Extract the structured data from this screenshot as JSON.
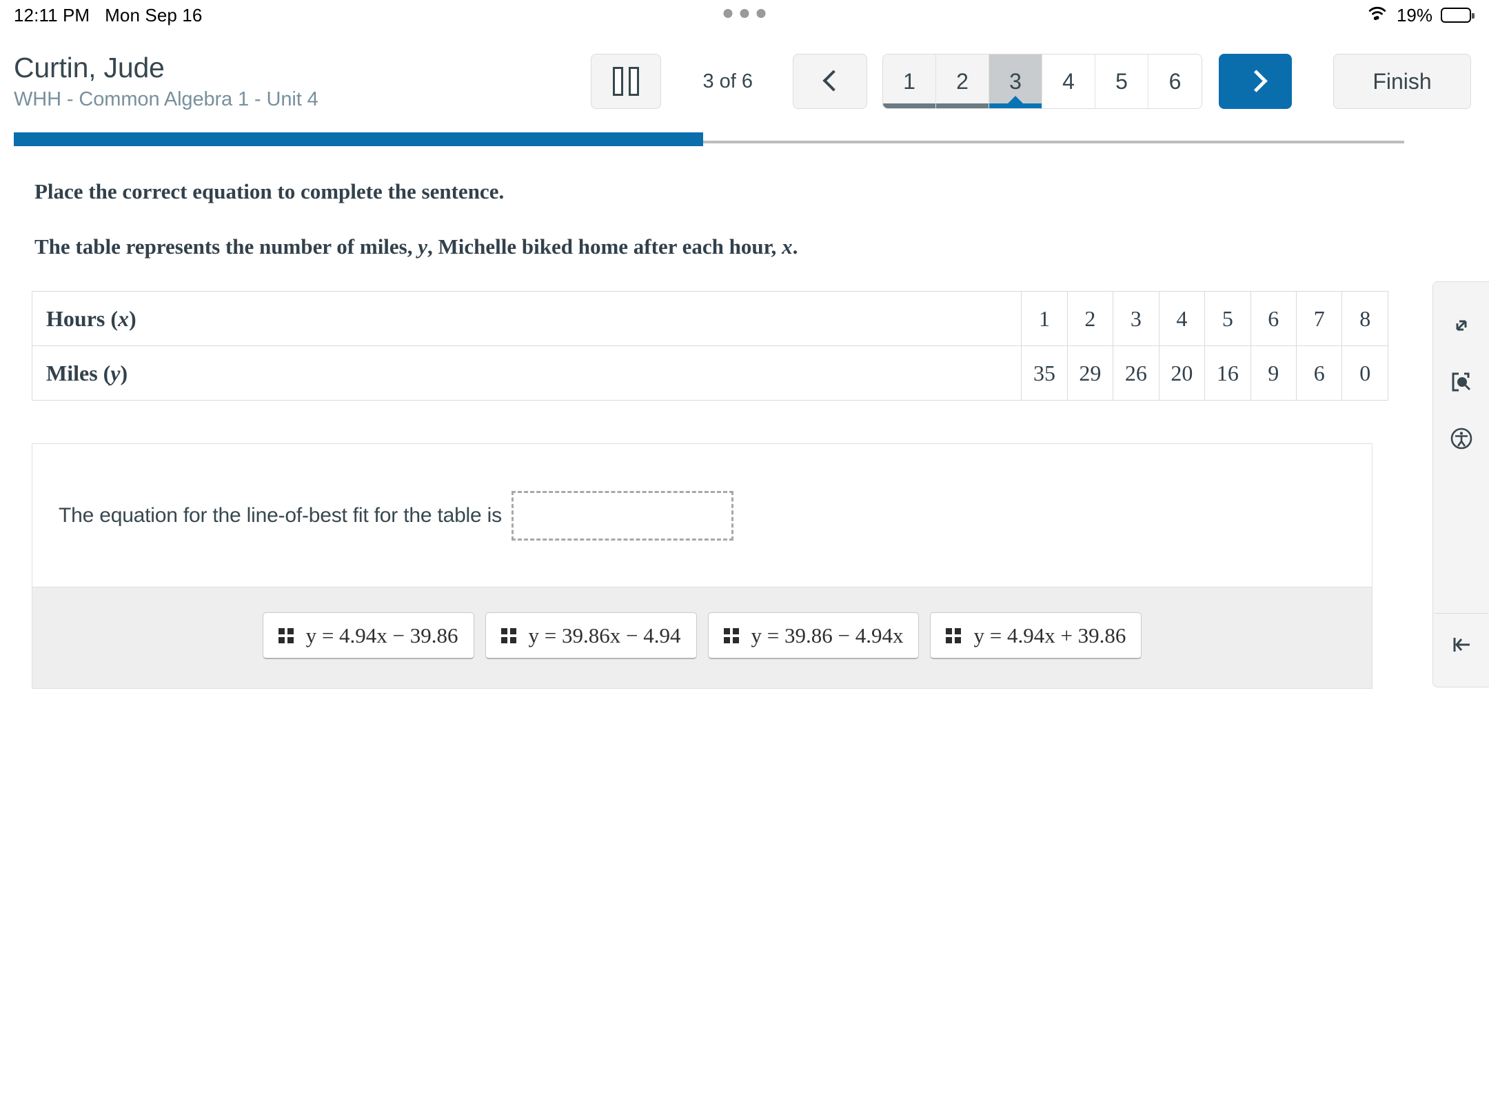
{
  "status_bar": {
    "time": "12:11 PM",
    "date": "Mon Sep 16",
    "battery_percent": "19%",
    "wifi_icon": "wifi-icon",
    "battery_icon": "battery-icon",
    "multitask_icon": "multitask-handle-icon"
  },
  "header": {
    "student_name": "Curtin, Jude",
    "course": "WHH - Common Algebra 1 - Unit 4",
    "pause_label": "pause-icon",
    "page_counter": "3 of 6",
    "prev_label": "chevron-left-icon",
    "next_label": "chevron-right-icon",
    "finish_label": "Finish",
    "pages": [
      {
        "label": "1",
        "state": "visited"
      },
      {
        "label": "2",
        "state": "visited"
      },
      {
        "label": "3",
        "state": "current"
      },
      {
        "label": "4",
        "state": "unvisited"
      },
      {
        "label": "5",
        "state": "unvisited"
      },
      {
        "label": "6",
        "state": "unvisited"
      }
    ],
    "current_page": 3,
    "total_pages": 6
  },
  "progress": {
    "percent": 50,
    "fill_color": "#0a6ead",
    "track_color": "#bdbdbd"
  },
  "question": {
    "instruction": "Place the correct equation to complete the sentence.",
    "stem_pre": "The table represents the number of miles, ",
    "stem_var_y": "y",
    "stem_mid": ", Michelle biked home after each hour, ",
    "stem_var_x": "x",
    "stem_post": "."
  },
  "chart_data": {
    "type": "table",
    "title": "The table represents the number of miles, y, Michelle biked home after each hour, x.",
    "row_labels": [
      "Hours (x)",
      "Miles (y)"
    ],
    "xlabel": "Hours (x)",
    "ylabel": "Miles (y)",
    "x": [
      1,
      2,
      3,
      4,
      5,
      6,
      7,
      8
    ],
    "values": [
      35,
      29,
      26,
      20,
      16,
      9,
      6,
      0
    ],
    "series": [
      {
        "name": "Hours (x)",
        "values": [
          1,
          2,
          3,
          4,
          5,
          6,
          7,
          8
        ]
      },
      {
        "name": "Miles (y)",
        "values": [
          35,
          29,
          26,
          20,
          16,
          9,
          6,
          0
        ]
      }
    ]
  },
  "table": {
    "hours_label_text": "Hours (",
    "hours_label_var": "x",
    "hours_label_close": ")",
    "miles_label_text": "Miles (",
    "miles_label_var": "y",
    "miles_label_close": ")",
    "hours": [
      "1",
      "2",
      "3",
      "4",
      "5",
      "6",
      "7",
      "8"
    ],
    "miles": [
      "35",
      "29",
      "26",
      "20",
      "16",
      "9",
      "6",
      "0"
    ]
  },
  "answer_area": {
    "sentence": "The equation for the line-of-best fit for the table is",
    "drop_zone_value": "",
    "options": [
      {
        "equation": "y = 4.94x − 39.86",
        "grip": "drag-handle-icon"
      },
      {
        "equation": "y = 39.86x − 4.94",
        "grip": "drag-handle-icon"
      },
      {
        "equation": "y = 39.86 − 4.94x",
        "grip": "drag-handle-icon"
      },
      {
        "equation": "y = 4.94x + 39.86",
        "grip": "drag-handle-icon"
      }
    ]
  },
  "tool_rail": {
    "buttons": [
      {
        "name": "expand-icon"
      },
      {
        "name": "zoom-region-icon"
      },
      {
        "name": "accessibility-icon"
      },
      {
        "name": "collapse-panel-icon"
      }
    ]
  }
}
